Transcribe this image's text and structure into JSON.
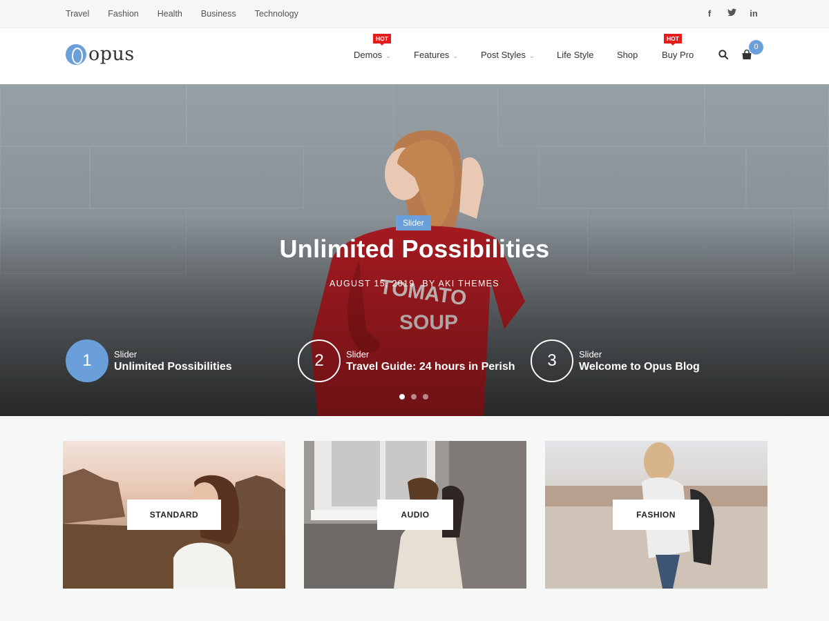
{
  "topbar": {
    "links": [
      "Travel",
      "Fashion",
      "Health",
      "Business",
      "Technology"
    ],
    "social": [
      {
        "icon": "facebook-icon",
        "glyph": "f"
      },
      {
        "icon": "twitter-icon",
        "glyph": "t"
      },
      {
        "icon": "linkedin-icon",
        "glyph": "in"
      }
    ]
  },
  "header": {
    "logo_text": "opus",
    "nav": [
      {
        "label": "Demos",
        "dropdown": true,
        "hot": "HOT"
      },
      {
        "label": "Features",
        "dropdown": true
      },
      {
        "label": "Post Styles",
        "dropdown": true
      },
      {
        "label": "Life Style",
        "dropdown": false
      },
      {
        "label": "Shop",
        "dropdown": false
      },
      {
        "label": "Buy Pro",
        "dropdown": false,
        "hot": "HOT"
      }
    ],
    "cart_count": "0"
  },
  "hero": {
    "category": "Slider",
    "title": "Unlimited Possibilities",
    "date": "AUGUST 15, 2019",
    "author": "BY AKI THEMES",
    "slides": [
      {
        "num": "1",
        "cat": "Slider",
        "title": "Unlimited Possibilities",
        "active": true
      },
      {
        "num": "2",
        "cat": "Slider",
        "title": "Travel Guide: 24 hours in Perish",
        "active": false
      },
      {
        "num": "3",
        "cat": "Slider",
        "title": "Welcome to Opus Blog",
        "active": false
      }
    ],
    "active_dot": 1,
    "dot_count": 3
  },
  "categories": [
    {
      "label": "STANDARD"
    },
    {
      "label": "AUDIO"
    },
    {
      "label": "FASHION"
    }
  ],
  "colors": {
    "accent": "#6a9fd9",
    "hot": "#e61b1b"
  }
}
